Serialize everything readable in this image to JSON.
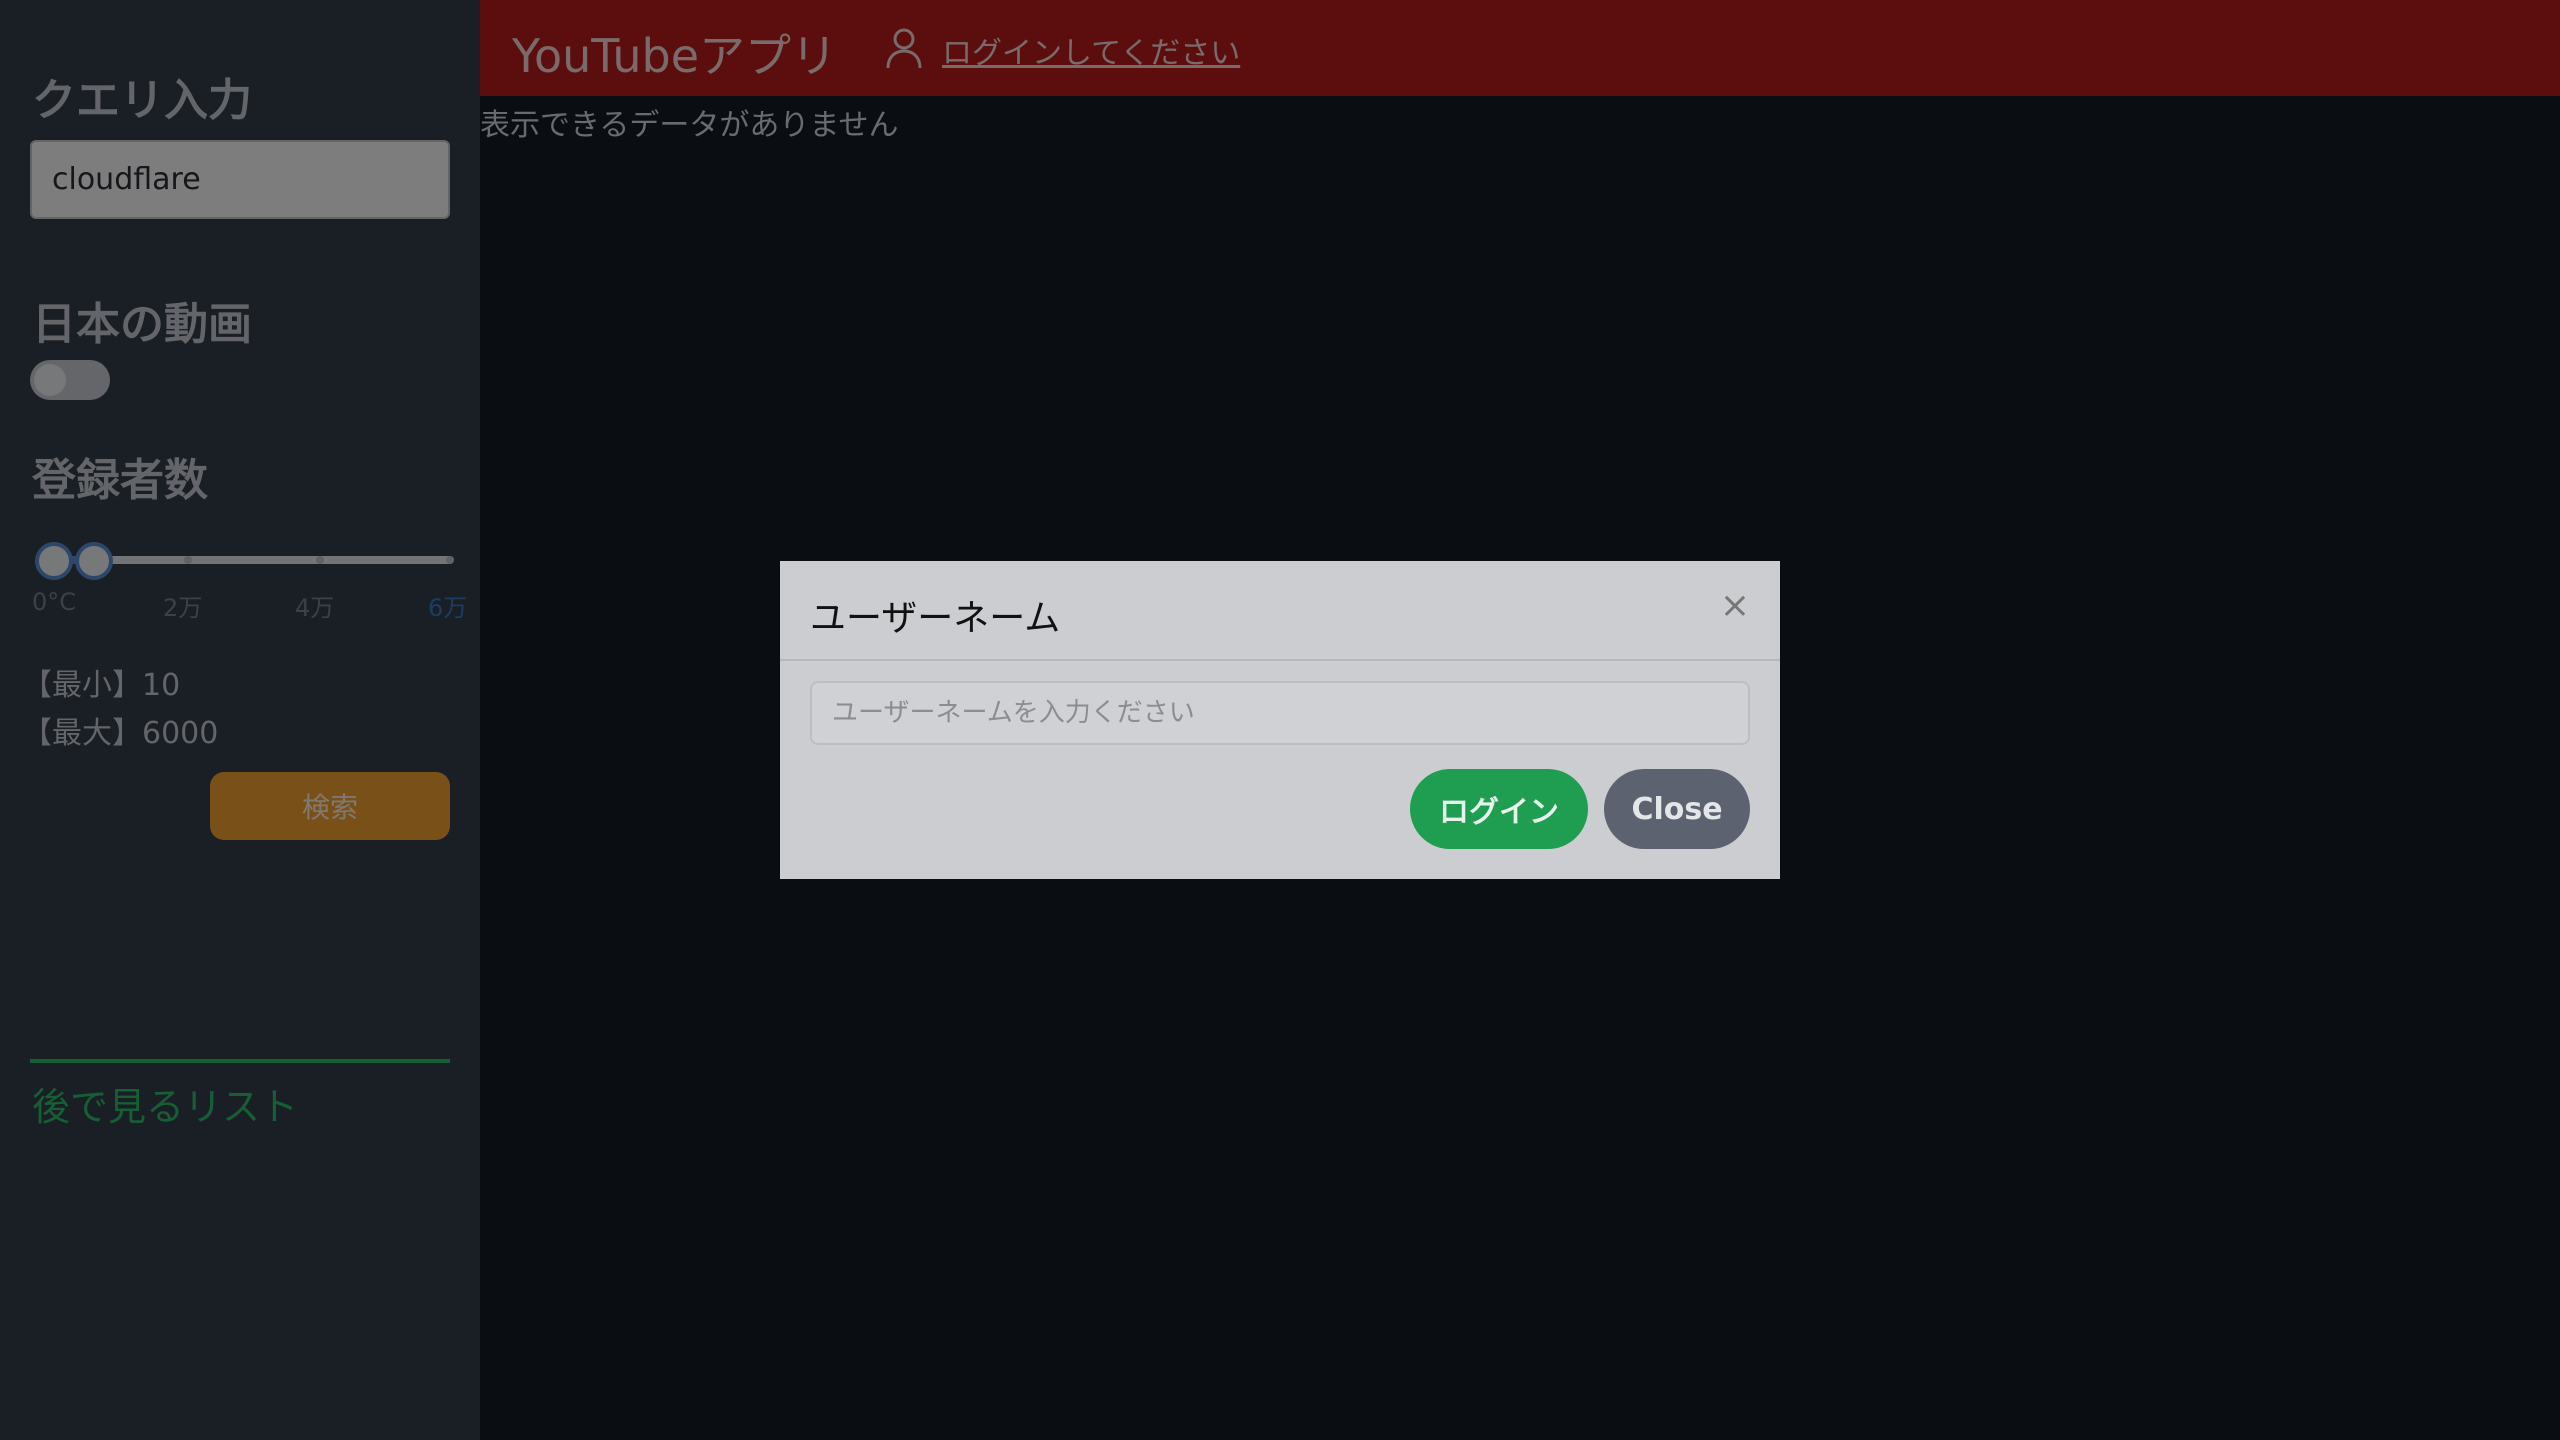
{
  "sidebar": {
    "query_heading": "クエリ入力",
    "query_value": "cloudflare",
    "japan_heading": "日本の動画",
    "japan_toggle_on": false,
    "subs_heading": "登録者数",
    "slider": {
      "ticks": [
        "0°C",
        "2万",
        "4万",
        "6万"
      ],
      "min": 0,
      "max": 60000,
      "low": 10,
      "high": 6000
    },
    "min_label": "【最小】10",
    "max_label": "【最大】6000",
    "search_label": "検索",
    "watch_later_label": "後で見るリスト"
  },
  "header": {
    "title": "YouTubeアプリ",
    "login_link": "ログインしてください",
    "user_icon": "user-icon"
  },
  "main": {
    "empty_message": "表示できるデータがありません"
  },
  "modal": {
    "title": "ユーザーネーム",
    "close_symbol": "×",
    "username_placeholder": "ユーザーネームを入力ください",
    "username_value": "",
    "login_label": "ログイン",
    "close_label": "Close"
  },
  "colors": {
    "header": "#b91c1c",
    "sidebar": "#343d4a",
    "search_button": "#f5a033",
    "watch_later": "#2dbd68",
    "login_button": "#1f9d50",
    "close_button": "#5d6270"
  }
}
